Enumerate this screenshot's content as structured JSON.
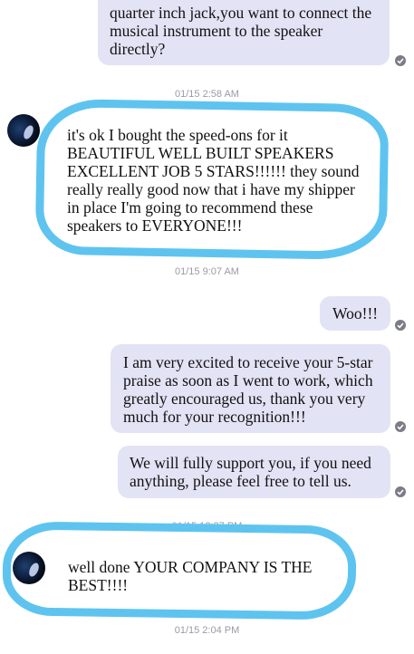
{
  "messages": {
    "m1": "quarter inch jack,you want to connect the musical instrument to the speaker directly?",
    "ts1": "01/15 2:58 AM",
    "m2": "it's ok I bought the speed-ons for it BEAUTIFUL WELL BUILT SPEAKERS EXCELLENT JOB 5 STARS!!!!!! they sound really really good now that i have my shipper in place I'm going to recommend these speakers to EVERYONE!!!",
    "ts2": "01/15 9:07 AM",
    "m3": "Woo!!!",
    "m4": "I am very excited to receive your 5-star praise as soon as I went to work, which greatly encouraged us, thank you very much for your recognition!!!",
    "m5": "We will fully support you, if you need anything, please feel free to tell us.",
    "ts3": "01/15 12:37 PM",
    "m6": "well done YOUR COMPANY IS THE BEST!!!!",
    "ts4": "01/15 2:04 PM"
  },
  "colors": {
    "outgoing_bubble": "#e3e3f6",
    "incoming_bubble": "#ffffff",
    "highlight_outline": "#5ec4ef",
    "timestamp_text": "#9a9aa6",
    "read_check": "#7c7c86"
  },
  "icons": {
    "read_receipt": "checkmark-circle-icon",
    "contact_avatar": "avatar"
  }
}
